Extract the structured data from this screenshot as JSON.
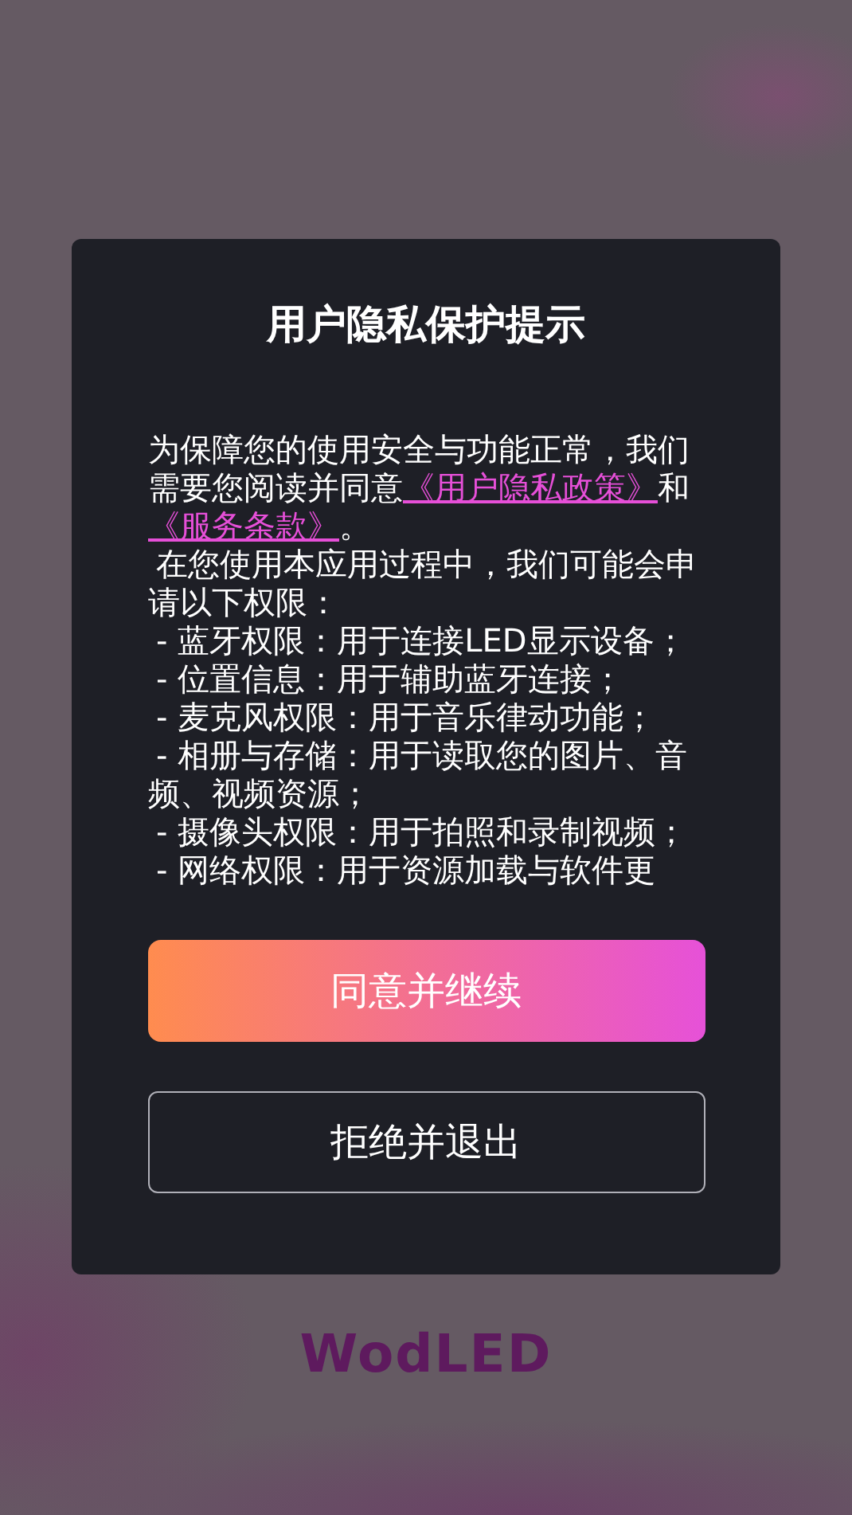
{
  "dialog": {
    "title": "用户隐私保护提示",
    "intro": [
      {
        "kind": "text",
        "text": "为保障您的使用安全与功能正常，我们需要您阅读并同意"
      },
      {
        "kind": "link",
        "text": "《用户隐私政策》"
      },
      {
        "kind": "text",
        "text": "和"
      },
      {
        "kind": "link",
        "text": "《服务条款》"
      },
      {
        "kind": "text",
        "text": "。"
      }
    ],
    "lines": [
      "在您使用本应用过程中，我们可能会申请以下权限：",
      "- 蓝牙权限：用于连接LED显示设备；",
      "- 位置信息：用于辅助蓝牙连接；",
      "- 麦克风权限：用于音乐律动功能；",
      "- 相册与存储：用于读取您的图片、音频、视频资源；",
      "- 摄像头权限：用于拍照和录制视频；",
      "- 网络权限：用于资源加载与软件更"
    ],
    "buttons": [
      {
        "kind": "primary",
        "label": "同意并继续"
      },
      {
        "kind": "outline",
        "label": "拒绝并退出"
      }
    ]
  },
  "logo": "WodLED"
}
